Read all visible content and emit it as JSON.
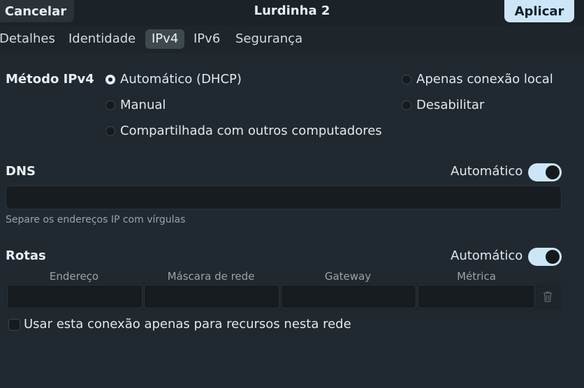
{
  "header": {
    "cancel_label": "Cancelar",
    "title": "Lurdinha 2",
    "apply_label": "Aplicar"
  },
  "tabs": [
    {
      "label": "Detalhes",
      "active": false
    },
    {
      "label": "Identidade",
      "active": false
    },
    {
      "label": "IPv4",
      "active": true
    },
    {
      "label": "IPv6",
      "active": false
    },
    {
      "label": "Segurança",
      "active": false
    }
  ],
  "ipv4": {
    "method_label": "Método IPv4",
    "options": [
      {
        "label": "Automático (DHCP)",
        "selected": true
      },
      {
        "label": "Manual",
        "selected": false
      },
      {
        "label": "Compartilhada com outros computadores",
        "selected": false
      },
      {
        "label": "Apenas conexão local",
        "selected": false
      },
      {
        "label": "Desabilitar",
        "selected": false
      }
    ]
  },
  "dns": {
    "label": "DNS",
    "auto_label": "Automático",
    "auto_on": true,
    "value": "",
    "hint": "Separe os endereços IP com vírgulas"
  },
  "routes": {
    "label": "Rotas",
    "auto_label": "Automático",
    "auto_on": true,
    "columns": [
      "Endereço",
      "Máscara de rede",
      "Gateway",
      "Métrica"
    ]
  },
  "options": {
    "only_local_label": "Usar esta conexão apenas para recursos nesta rede",
    "only_local_checked": false
  },
  "colors": {
    "background": "#212930",
    "accent": "#cce6f8",
    "header": "#1c2328"
  },
  "icons": {
    "trash": "trash-icon"
  }
}
